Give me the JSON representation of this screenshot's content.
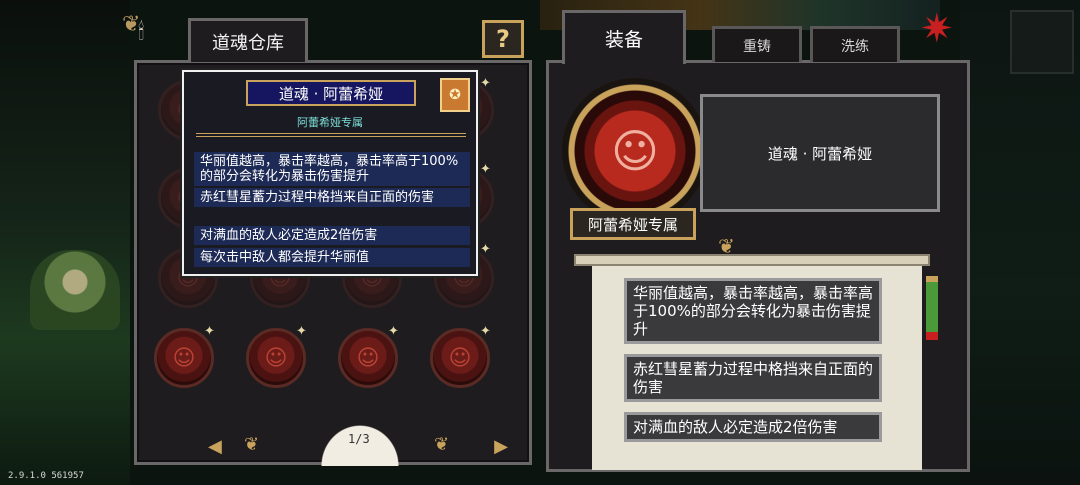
{
  "version": "2.9.1.0 561957",
  "left_panel": {
    "tab_title": "道魂仓库",
    "help_label": "?",
    "candle_icon": "candelabra-icon",
    "page_indicator": "1/3",
    "prev_icon": "arrow-left-icon",
    "next_icon": "arrow-right-icon"
  },
  "tooltip": {
    "title": "道魂 · 阿蕾希娅",
    "badge_icon": "star-badge-icon",
    "subtitle": "阿蕾希娅专属",
    "effects": [
      "华丽值越高，暴击率越高，暴击率高于100%的部分会转化为暴击伤害提升",
      "赤红彗星蓄力过程中格挡来自正面的伤害",
      "对满血的敌人必定造成2倍伤害",
      "每次击中敌人都会提升华丽值"
    ]
  },
  "right_panel": {
    "tabs": [
      {
        "label": "装备"
      },
      {
        "label": "重铸"
      },
      {
        "label": "洗练"
      }
    ],
    "soul_name": "道魂 · 阿蕾希娅",
    "exclusive_tag": "阿蕾希娅专属",
    "effects": [
      "华丽值越高，暴击率越高，暴击率高于100%的部分会转化为暴击伤害提升",
      "赤红彗星蓄力过程中格挡来自正面的伤害",
      "对满血的敌人必定造成2倍伤害"
    ]
  },
  "colors": {
    "panel_bg": "#1e1c1f",
    "border": "#6a6768",
    "gold": "#c9a35c",
    "tooltip_title_bg": "#151560",
    "tooltip_line_bg": "#1d2a55",
    "subtitle_cyan": "#7ce0d8",
    "soul_red": "#b82a1e"
  }
}
